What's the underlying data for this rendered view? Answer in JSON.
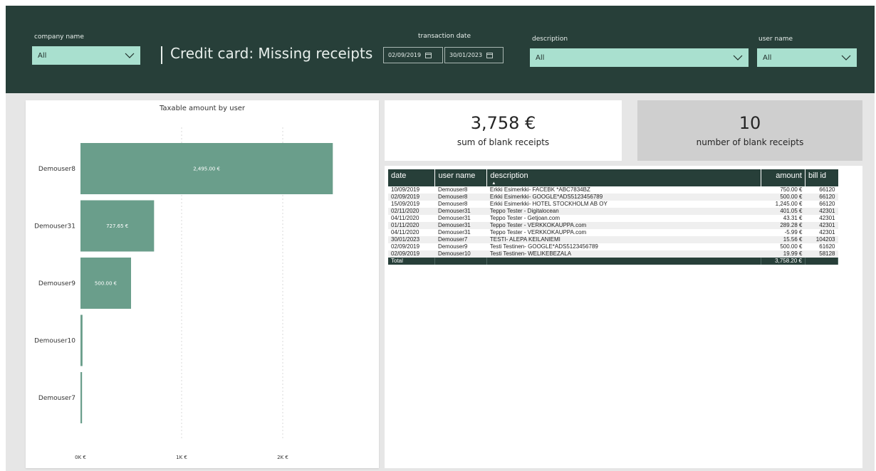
{
  "filters": {
    "company": {
      "title": "company name",
      "value": "All"
    },
    "date": {
      "title": "transaction date",
      "from": "02/09/2019",
      "to": "30/01/2023"
    },
    "description": {
      "title": "description",
      "value": "All"
    },
    "user": {
      "title": "user name",
      "value": "All"
    }
  },
  "page_title": "Credit card: Missing receipts",
  "kpis": {
    "sum": {
      "value": "3,758 €",
      "label": "sum of blank receipts"
    },
    "count": {
      "value": "10",
      "label": "number of blank receipts"
    }
  },
  "colors": {
    "header": "#273f39",
    "accent": "#a9e0cf",
    "bar": "#6a9e8b"
  },
  "table": {
    "headers": [
      "date",
      "user name",
      "description",
      "amount",
      "bill id"
    ],
    "rows": [
      [
        "10/09/2019",
        "Demouser8",
        "Erkki Esimerkki- FACEBK *ABC7834BZ",
        "750.00 €",
        "66120"
      ],
      [
        "02/09/2019",
        "Demouser8",
        "Erkki Esimerkki- GOOGLE*ADS5123456789",
        "500.00 €",
        "66120"
      ],
      [
        "15/09/2019",
        "Demouser8",
        "Erkki Esimerkki- HOTEL STOCKHOLM AB OY",
        "1,245.00 €",
        "66120"
      ],
      [
        "02/11/2020",
        "Demouser31",
        "Teppo Tester - Digitalocean",
        "401.05 €",
        "42301"
      ],
      [
        "04/11/2020",
        "Demouser31",
        "Teppo Tester - Getjoan.com",
        "43.31 €",
        "42301"
      ],
      [
        "01/11/2020",
        "Demouser31",
        "Teppo Tester - VERKKOKAUPPA.com",
        "289.28 €",
        "42301"
      ],
      [
        "04/11/2020",
        "Demouser31",
        "Teppo Tester - VERKKOKAUPPA.com",
        "-5.99 €",
        "42301"
      ],
      [
        "30/01/2023",
        "Demouser7",
        "TESTI- ALEPA KEILANIEMI",
        "15.56 €",
        "104203"
      ],
      [
        "02/09/2019",
        "Demouser9",
        "Testi Testinen- GOOGLE*ADS5123456789",
        "500.00 €",
        "61620"
      ],
      [
        "02/09/2019",
        "Demouser10",
        "Testi Testinen- WELIKEBEZALA",
        "19.99 €",
        "58128"
      ]
    ],
    "total": {
      "label": "Total",
      "amount": "3,758.20 €"
    }
  },
  "chart_data": {
    "type": "bar",
    "orientation": "horizontal",
    "title": "Taxable amount by user",
    "categories": [
      "Demouser8",
      "Demouser31",
      "Demouser9",
      "Demouser10",
      "Demouser7"
    ],
    "values": [
      2495.0,
      727.65,
      500.0,
      19.99,
      15.56
    ],
    "data_labels": [
      "2,495.00 €",
      "727.65 €",
      "500.00 €",
      "",
      ""
    ],
    "x_ticks": [
      0,
      1000,
      2000
    ],
    "x_tick_labels": [
      "0K €",
      "1K €",
      "2K €"
    ],
    "xlim": [
      0,
      2500
    ],
    "grid": true
  }
}
